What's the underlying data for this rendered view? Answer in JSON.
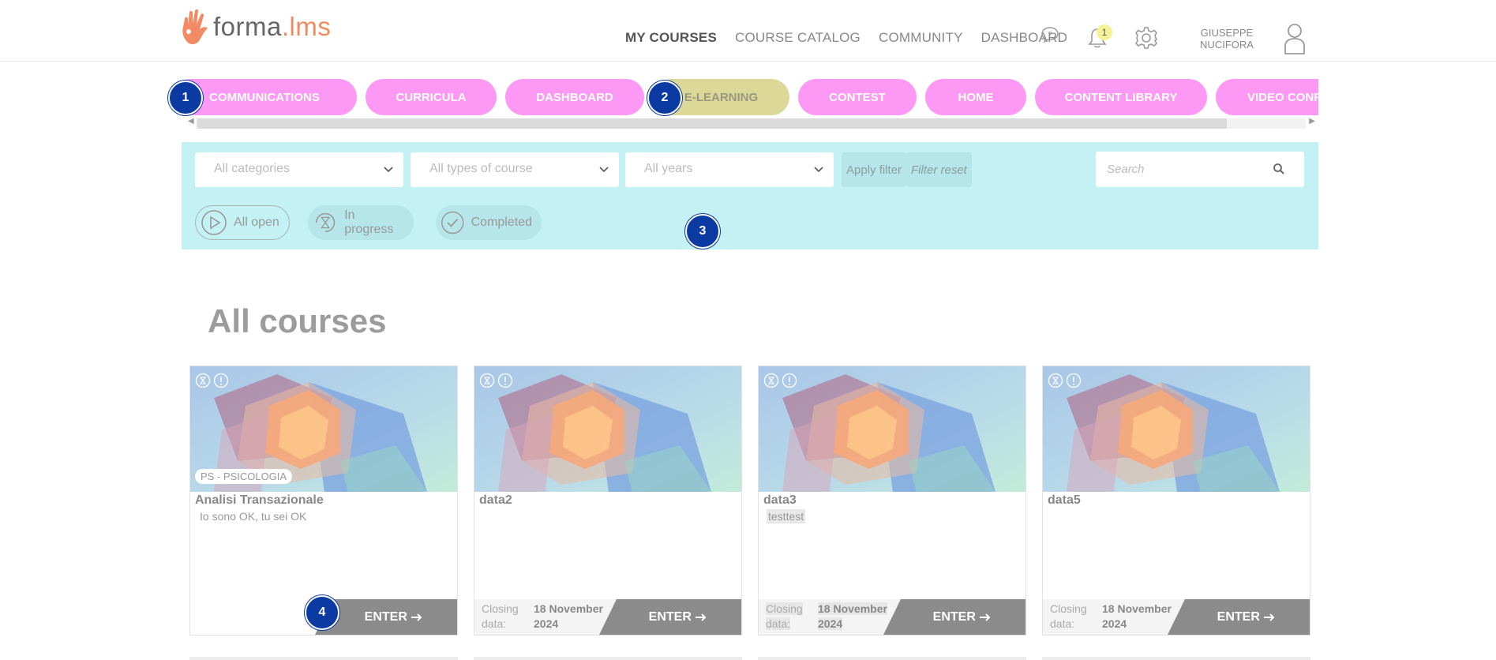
{
  "header": {
    "logo": {
      "text_main": "forma",
      "text_dot": ".",
      "text_lms": "lms"
    },
    "nav": [
      {
        "label": "MY COURSES",
        "active": true
      },
      {
        "label": "COURSE CATALOG",
        "active": false
      },
      {
        "label": "COMMUNITY",
        "active": false
      },
      {
        "label": "DASHBOARD",
        "active": false
      }
    ],
    "notifications_count": "1",
    "user_first": "GIUSEPPE",
    "user_last": "NUCIFORA",
    "icons": [
      "help-icon",
      "bell-icon",
      "gear-icon",
      "user-icon"
    ]
  },
  "pills": [
    {
      "label": "COMMUNICATIONS"
    },
    {
      "label": "CURRICULA"
    },
    {
      "label": "DASHBOARD"
    },
    {
      "label": "E-LEARNING",
      "muted": true
    },
    {
      "label": "CONTEST"
    },
    {
      "label": "HOME"
    },
    {
      "label": "CONTENT LIBRARY"
    },
    {
      "label": "VIDEO CONFERENCE"
    }
  ],
  "filters": {
    "category": "All categories",
    "course_type": "All types of course",
    "year": "All years",
    "apply": "Apply filter",
    "reset": "Filter reset",
    "search_placeholder": "Search",
    "status": [
      {
        "label": "All open",
        "selected": true
      },
      {
        "label": "In progress",
        "selected": false
      },
      {
        "label": "Completed",
        "selected": false
      }
    ]
  },
  "steps": [
    "1",
    "2",
    "3",
    "4"
  ],
  "page_title": "All courses",
  "courses": [
    {
      "category": "PS - PSICOLOGIA",
      "title": "Analisi Transazionale",
      "subtitle": "Io sono OK, tu sei OK",
      "closing_label": "",
      "closing_date": "",
      "enter": "ENTER"
    },
    {
      "category": "",
      "title": "data2",
      "subtitle": "",
      "closing_label_1": "Closing",
      "closing_label_2": "data:",
      "closing_date_1": "18 November",
      "closing_date_2": "2024",
      "enter": "ENTER"
    },
    {
      "category": "",
      "title": "data3",
      "subtitle": "testtest",
      "closing_label_1": "Closing",
      "closing_label_2": "data:",
      "closing_date_1": "18 November",
      "closing_date_2": "2024",
      "enter": "ENTER"
    },
    {
      "category": "",
      "title": "data5",
      "subtitle": "",
      "closing_label_1": "Closing",
      "closing_label_2": "data:",
      "closing_date_1": "18 November",
      "closing_date_2": "2024",
      "enter": "ENTER"
    }
  ],
  "colors": {
    "accent_pill": "#fd99f5",
    "muted_pill": "#dcd898",
    "filter_bg": "#c3f1f4",
    "step_marker": "#0b3aa3",
    "logo_accent": "#f08b5e"
  }
}
